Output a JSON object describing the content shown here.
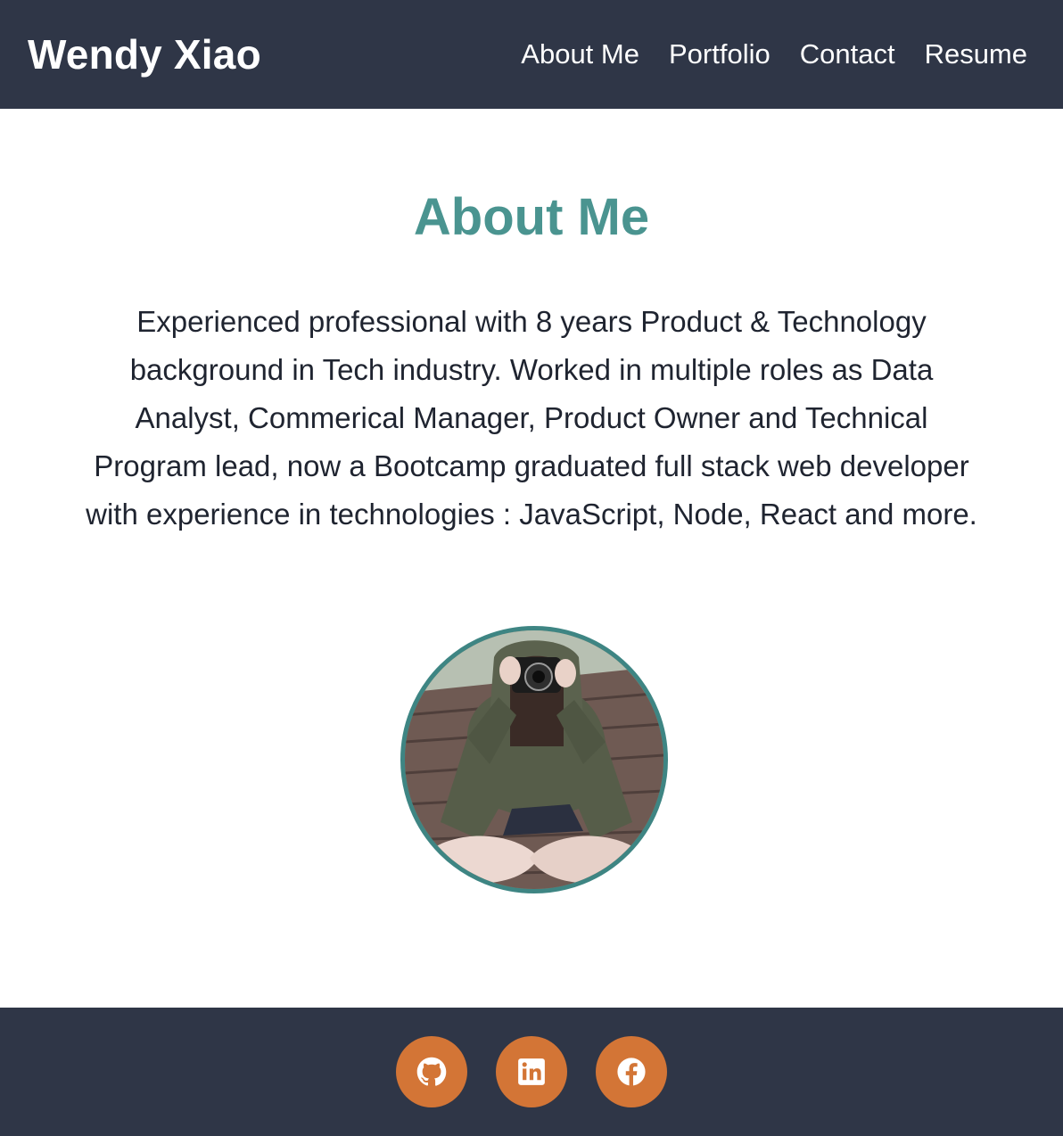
{
  "header": {
    "brand": "Wendy Xiao",
    "nav": [
      {
        "label": "About Me"
      },
      {
        "label": "Portfolio"
      },
      {
        "label": "Contact"
      },
      {
        "label": "Resume"
      }
    ]
  },
  "about": {
    "title": "About Me",
    "bio": "Experienced professional with 8 years Product & Technology background in Tech industry. Worked in multiple roles as Data Analyst, Commerical Manager, Product Owner and Technical Program lead, now a Bootcamp graduated full stack web developer with experience in technologies : JavaScript, Node, React and more.",
    "photo_icon": "profile-photo"
  },
  "footer": {
    "links": [
      {
        "icon": "github-icon"
      },
      {
        "icon": "linkedin-icon"
      },
      {
        "icon": "facebook-icon"
      }
    ]
  },
  "colors": {
    "header_bg": "#2f3647",
    "accent_teal": "#4a9490",
    "avatar_border": "#3e8583",
    "social_orange": "#d37536",
    "text": "#1f2430"
  }
}
